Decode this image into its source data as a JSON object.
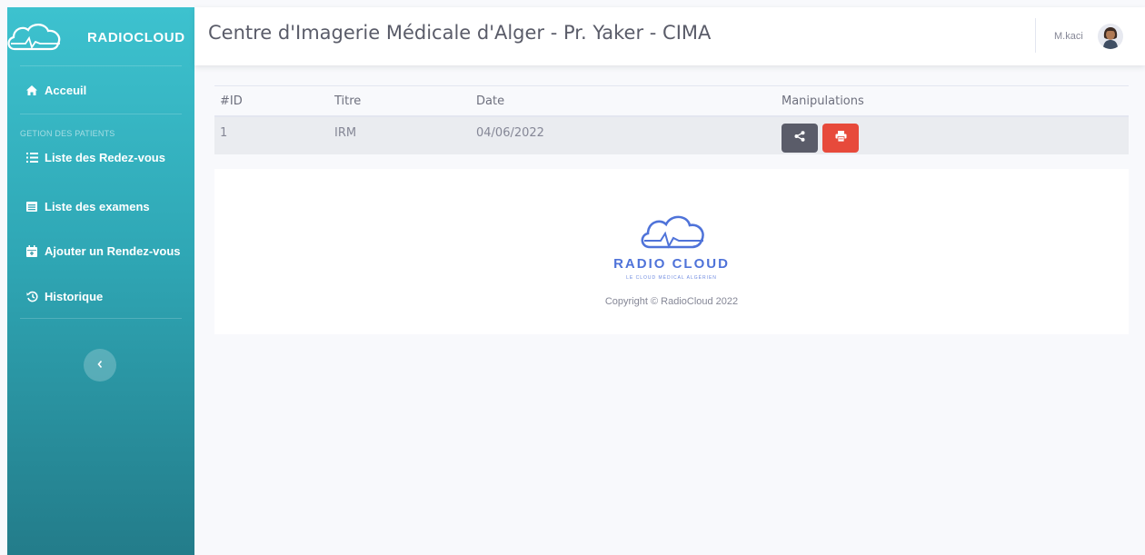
{
  "brand": {
    "name": "RADIOCLOUD"
  },
  "sidebar": {
    "home_label": "Acceuil",
    "section_heading": "GETION DES PATIENTS",
    "items": [
      {
        "label": "Liste des Redez-vous",
        "icon": "list-icon"
      },
      {
        "label": "Liste des examens",
        "icon": "table-icon"
      },
      {
        "label": "Ajouter un Rendez-vous",
        "icon": "calendar-icon"
      },
      {
        "label": "Historique",
        "icon": "history-icon"
      }
    ],
    "toggle_icon": "chevron-left-icon"
  },
  "topbar": {
    "title": "Centre d'Imagerie Médicale d'Alger - Pr. Yaker - CIMA",
    "user_name": "M.kaci"
  },
  "table": {
    "headers": [
      "#ID",
      "Titre",
      "Date",
      "Manipulations"
    ],
    "rows": [
      {
        "id": "1",
        "titre": "IRM",
        "date": "04/06/2022"
      }
    ],
    "actions": [
      {
        "icon": "share-icon",
        "color": "#5a5c69"
      },
      {
        "icon": "print-icon",
        "color": "#e74a3b"
      }
    ]
  },
  "footer": {
    "brand": "RADIO CLOUD",
    "tagline": "LE CLOUD MÉDICAL ALGÉRIEN",
    "copyright": "Copyright © RadioCloud 2022"
  },
  "colors": {
    "sidebar_top": "#3dc2cf",
    "sidebar_bottom": "#237c8a",
    "accent_blue": "#4f73d9",
    "danger": "#e74a3b",
    "dark": "#5a5c69"
  }
}
